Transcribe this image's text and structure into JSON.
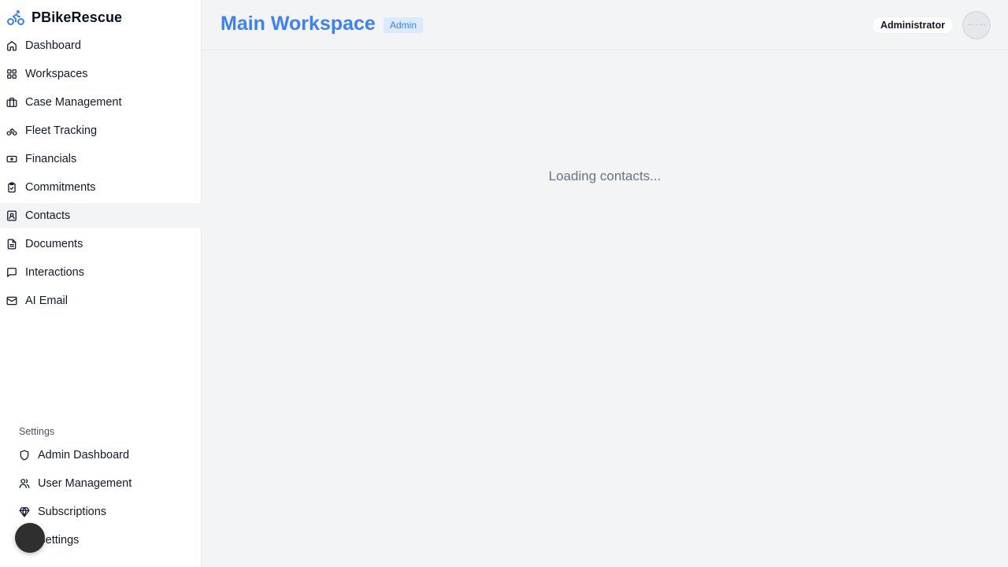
{
  "app": {
    "name": "PBikeRescue",
    "brand_icon": "bicycle-icon",
    "accent_color": "#3b82f6"
  },
  "sidebar": {
    "items": [
      {
        "label": "Dashboard",
        "icon": "home-icon"
      },
      {
        "label": "Workspaces",
        "icon": "grid-icon"
      },
      {
        "label": "Case Management",
        "icon": "briefcase-icon"
      },
      {
        "label": "Fleet Tracking",
        "icon": "bicycle-icon"
      },
      {
        "label": "Financials",
        "icon": "banknote-icon"
      },
      {
        "label": "Commitments",
        "icon": "clipboard-check-icon"
      },
      {
        "label": "Contacts",
        "icon": "contact-icon",
        "active": true
      },
      {
        "label": "Documents",
        "icon": "file-text-icon"
      },
      {
        "label": "Interactions",
        "icon": "message-square-icon"
      },
      {
        "label": "AI Email",
        "icon": "mail-icon"
      }
    ],
    "settings": {
      "title": "Settings",
      "items": [
        {
          "label": "Admin Dashboard",
          "icon": "shield-icon"
        },
        {
          "label": "User Management",
          "icon": "users-icon"
        },
        {
          "label": "Subscriptions",
          "icon": "gem-icon"
        },
        {
          "label": "Settings",
          "icon": "gear-icon"
        }
      ]
    }
  },
  "header": {
    "title": "Main Workspace",
    "badge": "Admin",
    "role": "Administrator"
  },
  "main": {
    "loading_text": "Loading contacts..."
  }
}
